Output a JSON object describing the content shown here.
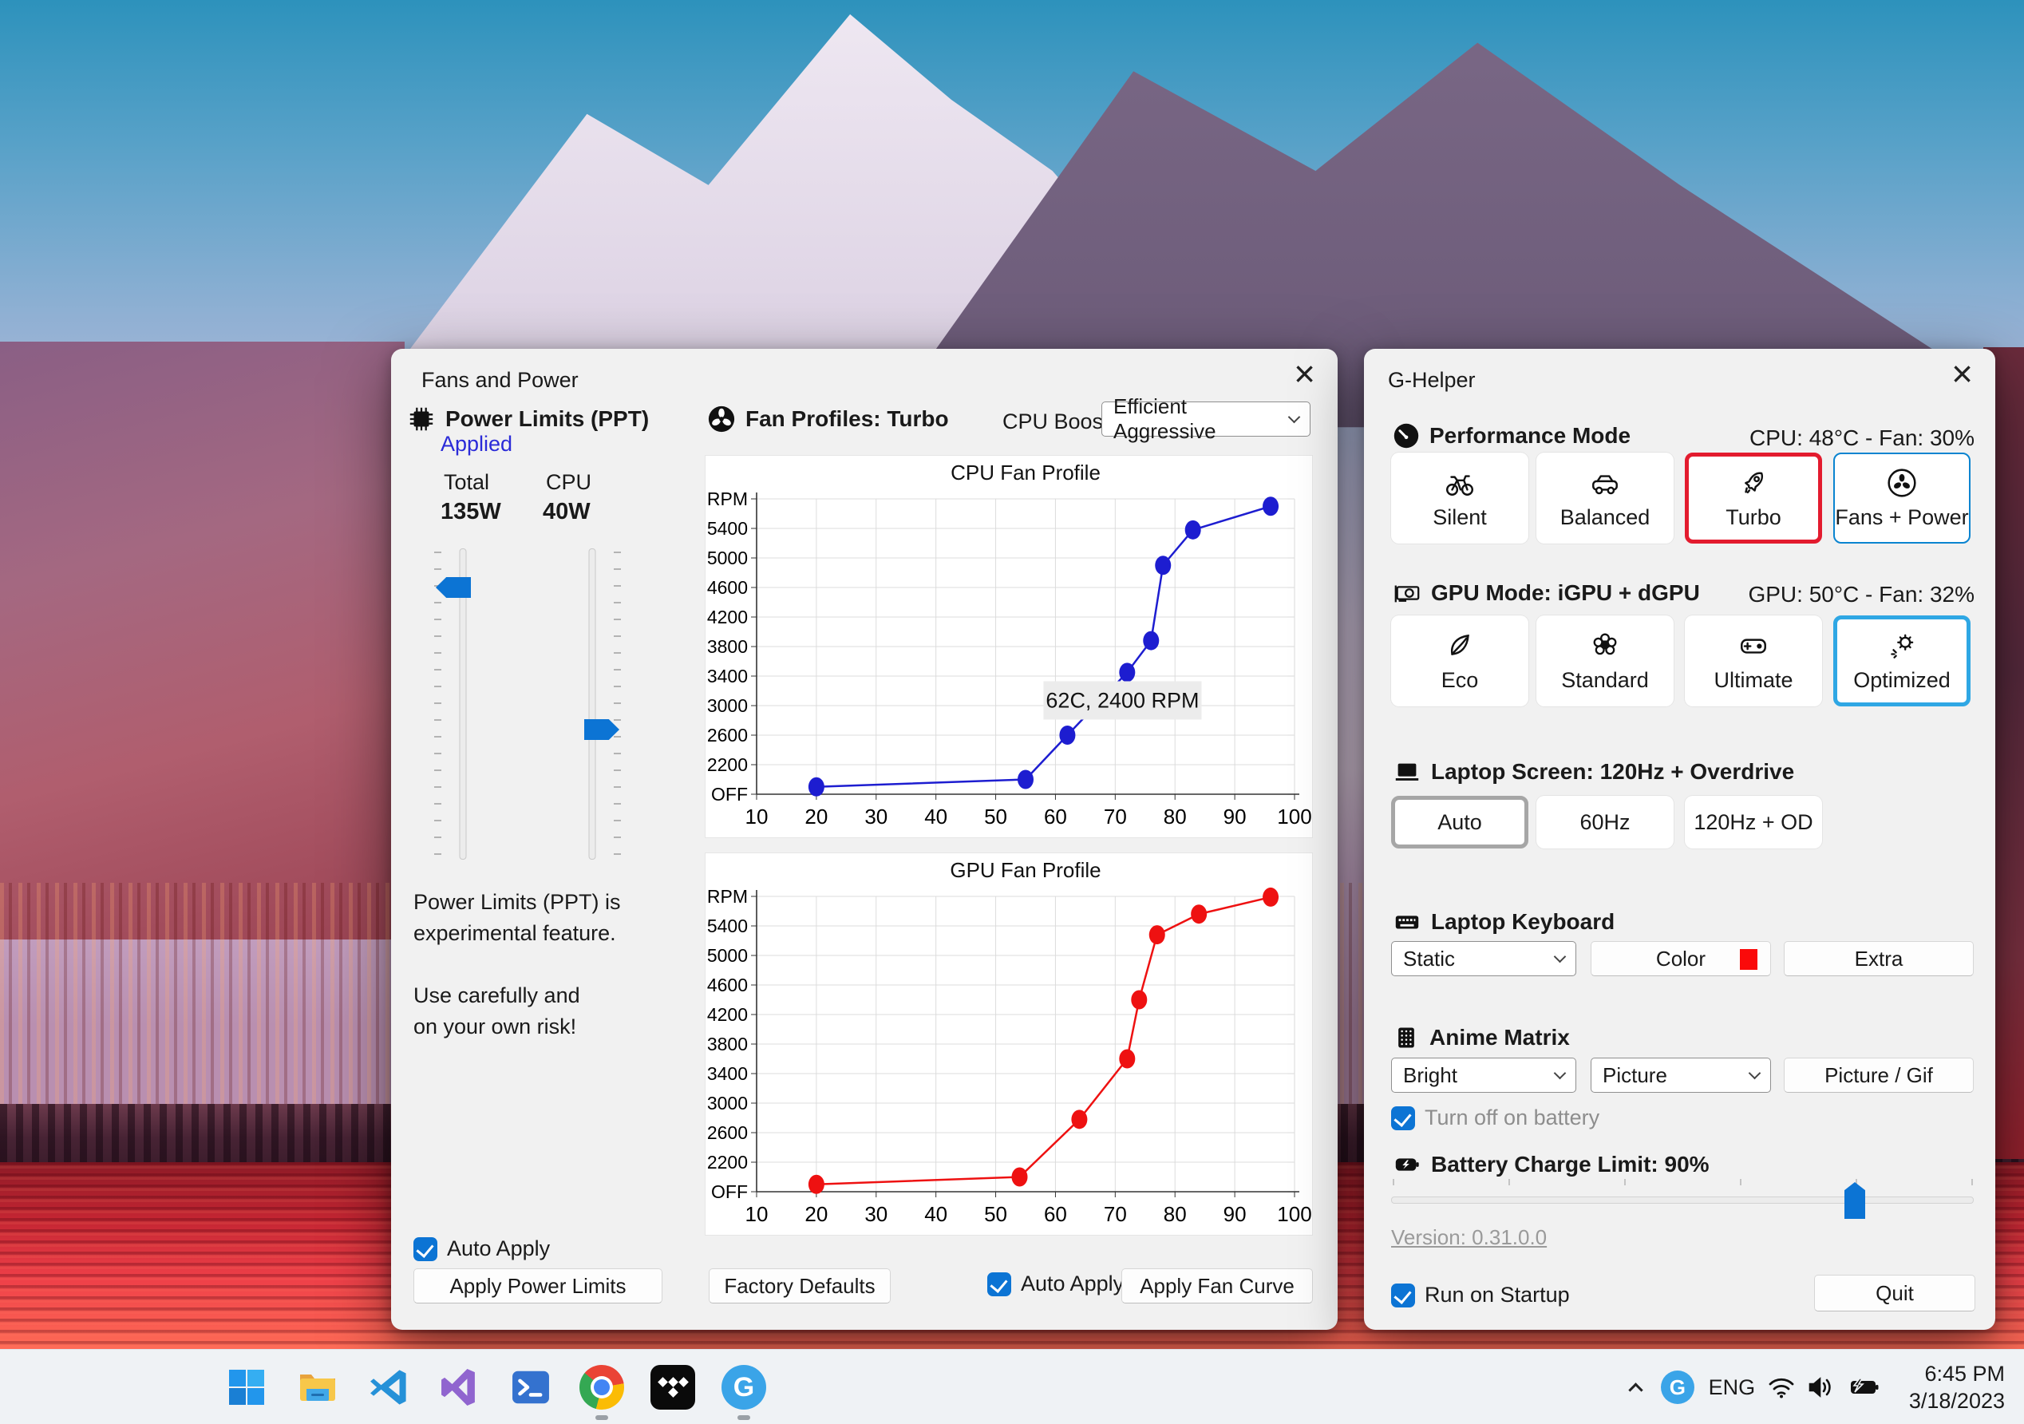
{
  "colors": {
    "accent": "#0c74d4",
    "selected_red": "#e31b2e",
    "selected_blue": "#2fa7e4",
    "info_blue": "#2b2bd8"
  },
  "fans_window": {
    "title": "Fans and Power",
    "close_glyph": "×",
    "power_limits": {
      "header": "Power Limits (PPT)",
      "status": "Applied",
      "total_label": "Total",
      "total_value": "135W",
      "cpu_label": "CPU",
      "cpu_value": "40W",
      "note_line1": "Power Limits (PPT) is",
      "note_line2": "experimental feature.",
      "note_line3": "Use carefully and",
      "note_line4": "on your own risk!",
      "auto_apply_label": "Auto Apply",
      "apply_button": "Apply Power Limits"
    },
    "fan_profiles": {
      "header": "Fan Profiles: Turbo",
      "cpu_boost_label": "CPU Boost",
      "cpu_boost_value": "Efficient Aggressive",
      "factory_defaults_button": "Factory Defaults",
      "auto_apply_label": "Auto Apply",
      "apply_button": "Apply Fan Curve"
    }
  },
  "chart_data": [
    {
      "type": "line",
      "title": "CPU Fan Profile",
      "x": [
        20,
        55,
        62,
        72,
        76,
        78,
        83,
        96
      ],
      "y": [
        1900,
        2000,
        2600,
        3450,
        3880,
        4900,
        5380,
        5700
      ],
      "color": "#1d1dd0",
      "xlim": [
        10,
        100
      ],
      "ylim": [
        1800,
        5800
      ],
      "x_ticks": [
        10,
        20,
        30,
        40,
        50,
        60,
        70,
        80,
        90,
        100
      ],
      "y_ticks": [
        {
          "v": 1800,
          "label": "OFF"
        },
        {
          "v": 2200,
          "label": "2200"
        },
        {
          "v": 2600,
          "label": "2600"
        },
        {
          "v": 3000,
          "label": "3000"
        },
        {
          "v": 3400,
          "label": "3400"
        },
        {
          "v": 3800,
          "label": "3800"
        },
        {
          "v": 4200,
          "label": "4200"
        },
        {
          "v": 4600,
          "label": "4600"
        },
        {
          "v": 5000,
          "label": "5000"
        },
        {
          "v": 5400,
          "label": "5400"
        },
        {
          "v": 5800,
          "label": "RPM"
        }
      ],
      "grid": true,
      "xlabel": "",
      "ylabel": "RPM",
      "annotation": {
        "text": "62C, 2400 RPM",
        "x": 58,
        "y": 3330
      }
    },
    {
      "type": "line",
      "title": "GPU Fan Profile",
      "x": [
        20,
        54,
        64,
        72,
        74,
        77,
        84,
        96
      ],
      "y": [
        1900,
        2000,
        2780,
        3600,
        4400,
        5280,
        5560,
        5790
      ],
      "color": "#ee1111",
      "xlim": [
        10,
        100
      ],
      "ylim": [
        1800,
        5800
      ],
      "x_ticks": [
        10,
        20,
        30,
        40,
        50,
        60,
        70,
        80,
        90,
        100
      ],
      "y_ticks": [
        {
          "v": 1800,
          "label": "OFF"
        },
        {
          "v": 2200,
          "label": "2200"
        },
        {
          "v": 2600,
          "label": "2600"
        },
        {
          "v": 3000,
          "label": "3000"
        },
        {
          "v": 3400,
          "label": "3400"
        },
        {
          "v": 3800,
          "label": "3800"
        },
        {
          "v": 4200,
          "label": "4200"
        },
        {
          "v": 4600,
          "label": "4600"
        },
        {
          "v": 5000,
          "label": "5000"
        },
        {
          "v": 5400,
          "label": "5400"
        },
        {
          "v": 5800,
          "label": "RPM"
        }
      ],
      "grid": true,
      "xlabel": "",
      "ylabel": "RPM",
      "annotation": null
    }
  ],
  "ghelper_window": {
    "title": "G-Helper",
    "close_glyph": "×",
    "performance": {
      "header": "Performance Mode",
      "status": "CPU: 48°C -  Fan: 30%",
      "buttons": [
        {
          "label": "Silent",
          "icon": "bicycle-icon"
        },
        {
          "label": "Balanced",
          "icon": "car-icon"
        },
        {
          "label": "Turbo",
          "icon": "rocket-icon",
          "selected": "red"
        },
        {
          "label": "Fans + Power",
          "icon": "fan-icon",
          "selected": "blue-thin"
        }
      ]
    },
    "gpu": {
      "header": "GPU Mode: iGPU + dGPU",
      "status": "GPU: 50°C -  Fan: 32%",
      "buttons": [
        {
          "label": "Eco",
          "icon": "leaf-icon"
        },
        {
          "label": "Standard",
          "icon": "flower-icon"
        },
        {
          "label": "Ultimate",
          "icon": "gamepad-icon"
        },
        {
          "label": "Optimized",
          "icon": "gear-sparkle-icon",
          "selected": "blue"
        }
      ]
    },
    "screen": {
      "header": "Laptop Screen: 120Hz + Overdrive",
      "buttons": [
        {
          "label": "Auto",
          "selected": "gray"
        },
        {
          "label": "60Hz"
        },
        {
          "label": "120Hz + OD"
        }
      ]
    },
    "keyboard": {
      "header": "Laptop Keyboard",
      "mode_value": "Static",
      "color_button": "Color",
      "swatch_color": "#fa0a0a",
      "extra_button": "Extra"
    },
    "matrix": {
      "header": "Anime Matrix",
      "brightness_value": "Bright",
      "mode_value": "Picture",
      "picture_button": "Picture / Gif",
      "battery_checkbox_label": "Turn off on battery"
    },
    "battery": {
      "header": "Battery Charge Limit: 90%",
      "slider_percent": 78
    },
    "version_link": "Version: 0.31.0.0",
    "startup_checkbox_label": "Run on Startup",
    "quit_button": "Quit"
  },
  "taskbar": {
    "language": "ENG",
    "time": "6:45 PM",
    "date": "3/18/2023",
    "ghelper_letter": "G"
  }
}
